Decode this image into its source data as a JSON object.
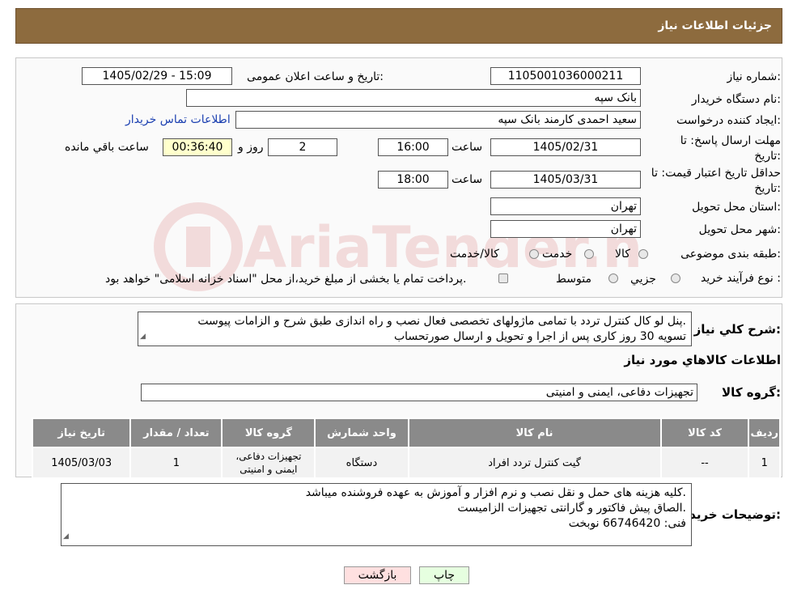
{
  "header": {
    "title": "جزئیات اطلاعات نیاز"
  },
  "form": {
    "need_number_label": "شماره نیاز:",
    "need_number": "1105001036000211",
    "announce_label": "تاریخ و ساعت اعلان عمومی:",
    "announce_value": "1405/02/29 - 15:09",
    "buyer_org_label": "نام دستگاه خریدار:",
    "buyer_org": "بانک سپه",
    "creator_label": "ایجاد کننده درخواست:",
    "creator": "سعید احمدی کارمند بانک سپه",
    "contact_link": "اطلاعات تماس خریدار",
    "reply_deadline_label": "مهلت ارسال پاسخ: تا تاریخ:",
    "reply_date": "1405/02/31",
    "time_label": "ساعت",
    "reply_time": "16:00",
    "days_value": "2",
    "days_label": "روز و",
    "remaining_time": "00:36:40",
    "remaining_label": "ساعت باقي مانده",
    "validity_label": "حداقل تاریخ اعتبار قیمت: تا تاریخ:",
    "validity_date": "1405/03/31",
    "validity_time": "18:00",
    "province_label": "استان محل تحویل:",
    "province": "تهران",
    "city_label": "شهر محل تحویل:",
    "city": "تهران",
    "category_label": "طبقه بندی موضوعی:",
    "category_options": [
      "کالا",
      "خدمت",
      "کالا/خدمت"
    ],
    "purchase_type_label": "نوع فرآیند خرید :",
    "purchase_options": [
      "جزيي",
      "متوسط"
    ],
    "purchase_note": "پرداخت تمام یا بخشی از مبلغ خرید،از محل \"اسناد خزانه اسلامی\" خواهد بود."
  },
  "description": {
    "label": "شرح کلي نياز:",
    "lines": [
      "پنل لو کال کنترل تردد با تمامی ماژولهای تخصصی فعال نصب و راه اندازی طبق شرح و الزامات پیوست.",
      "تسویه 30 روز کاری پس از اجرا و تحویل و ارسال صورتحساب"
    ],
    "goods_info_title": "اطلاعات کالاهاي مورد نياز",
    "goods_group_label": "گروه کالا:",
    "goods_group": "تجهیزات دفاعی، ایمنی و امنیتی"
  },
  "table": {
    "headers": [
      "رديف",
      "کد کالا",
      "نام کالا",
      "واحد شمارش",
      "گروه کالا",
      "تعداد / مقدار",
      "تاریخ نیاز"
    ],
    "rows": [
      [
        "1",
        "--",
        "گیت کنترل تردد افراد",
        "دستگاه",
        "تجهیزات دفاعی، ایمنی و امنیتی",
        "1",
        "1405/03/03"
      ]
    ]
  },
  "buyer_notes": {
    "label": "توضیحات خریدار:",
    "lines": [
      "کلیه هزینه های حمل و نقل نصب و نرم افزار و آموزش به عهده فروشنده میباشد.",
      "الصاق پیش فاکتور و گارانتی تجهیزات الزامیست.",
      "فنی: 66746420 نوبخت"
    ]
  },
  "buttons": {
    "print": "چاپ",
    "back": "بازگشت"
  },
  "colors": {
    "header_bg": "#8d6b3e",
    "print_bg": "#e6ffe0",
    "back_bg": "#ffe0e0",
    "link": "#1a3fb0"
  }
}
